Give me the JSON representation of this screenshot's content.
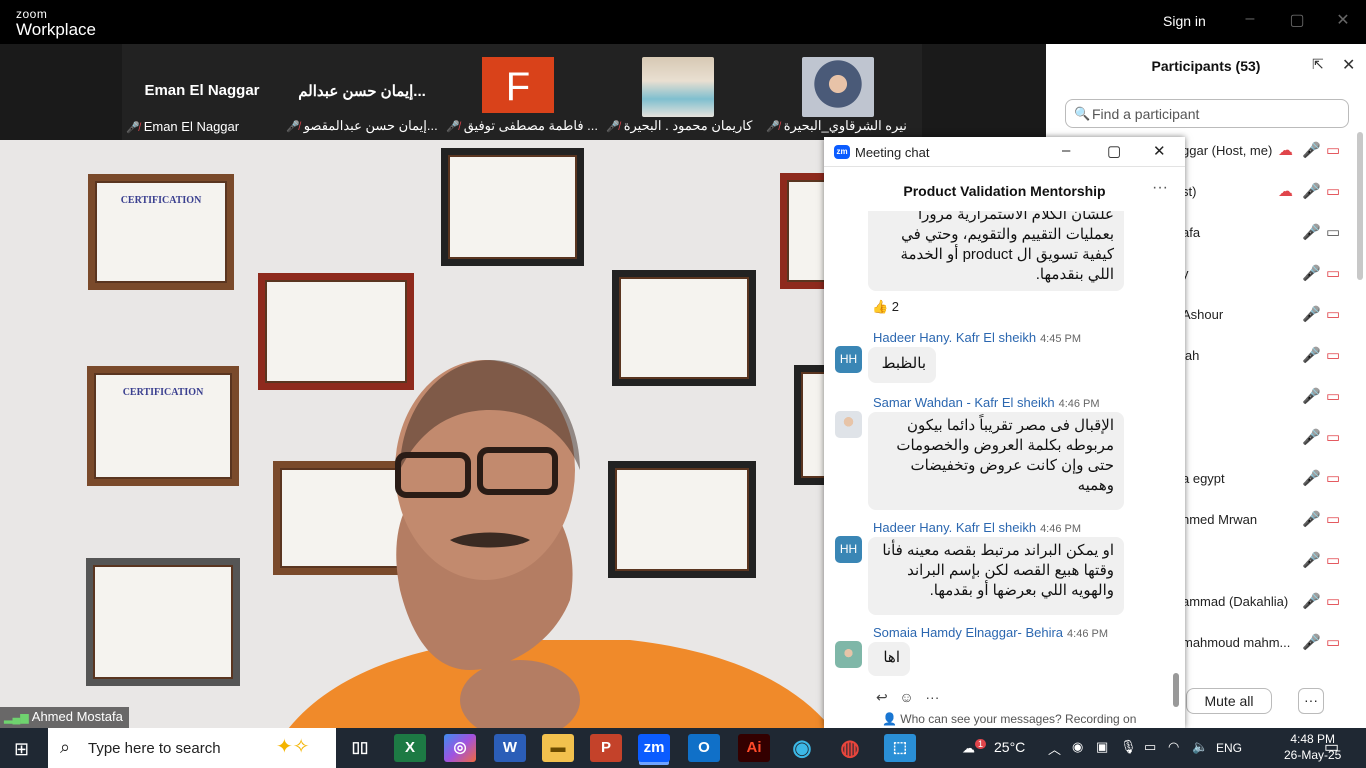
{
  "app": {
    "logo_top": "zoom",
    "logo_bottom": "Workplace",
    "signin": "Sign in"
  },
  "window_controls": {
    "minimize": "–",
    "maximize": "▢",
    "close": "✕"
  },
  "tiles": [
    {
      "name": "Eman El Naggar",
      "label": "Eman El Naggar",
      "kind": "name"
    },
    {
      "name": "إيمان حسن عبدالم...",
      "label": "إيمان حسن عبدالمقصو...",
      "kind": "name"
    },
    {
      "avatar": "F",
      "label": "فاطمة مصطفى توفيق ...",
      "kind": "avatar",
      "avatar_color": "#d9421a"
    },
    {
      "label": "كاريمان محمود . البحيرة",
      "kind": "photo"
    },
    {
      "label": "نيره الشرقاوي_البحيرة",
      "kind": "photo"
    }
  ],
  "speaker": {
    "name": "Ahmed Mostafa"
  },
  "participants": {
    "title": "Participants (53)",
    "search_placeholder": "Find a participant",
    "items": [
      {
        "name": "ggar (Host, me)"
      },
      {
        "name": "st)"
      },
      {
        "name": "afa"
      },
      {
        "name": "y"
      },
      {
        "name": "Ashour"
      },
      {
        "name": "lah"
      },
      {
        "name": ""
      },
      {
        "name": ""
      },
      {
        "name": "a egypt"
      },
      {
        "name": "nmed Mrwan"
      },
      {
        "name": ""
      },
      {
        "name": "ammad  (Dakahlia)"
      },
      {
        "name": "mahmoud mahm..."
      }
    ],
    "mute_all": "Mute all",
    "more": "···"
  },
  "chat": {
    "window_title": "Meeting chat",
    "subtitle": "Product Validation Mentorship",
    "messages": [
      {
        "sender": "",
        "time": "",
        "text": "علشان الكلام الاستمرارية مرورا بعمليات التقييم والتقويم، وحتي في كيفية تسويق ال product أو الخدمة اللي بنقدمها.",
        "reaction": "👍 2"
      },
      {
        "sender": "Hadeer Hany. Kafr El sheikh",
        "time": "4:45 PM",
        "text": "بالظبط",
        "initials": "HH"
      },
      {
        "sender": "Samar Wahdan - Kafr El sheikh",
        "time": "4:46 PM",
        "text": "الإقبال فى مصر تقريباً دائما بيكون مربوطه بكلمة العروض والخصومات حتى وإن كانت عروض وتخفيضات وهميه"
      },
      {
        "sender": "Hadeer Hany. Kafr El sheikh",
        "time": "4:46 PM",
        "text": "او يمكن البراند مرتبط بقصه معينه فأنا وقتها هبيع القصه لكن بإسم البراند والهويه اللي بعرضها أو بقدمها.",
        "initials": "HH"
      },
      {
        "sender": "Somaia Hamdy Elnaggar- Behira",
        "time": "4:46 PM",
        "text": "اها"
      }
    ],
    "footer_note": "Who can see your messages? Recording on"
  },
  "taskbar": {
    "search_placeholder": "Type here to search",
    "temperature": "25°C",
    "weather_badge": "1",
    "language": "ENG",
    "time": "4:48 PM",
    "date": "26-May-25"
  },
  "colors": {
    "mic_muted": "#e0454b",
    "zoom_blue": "#0b5cff",
    "sender_link": "#2b67b0"
  }
}
